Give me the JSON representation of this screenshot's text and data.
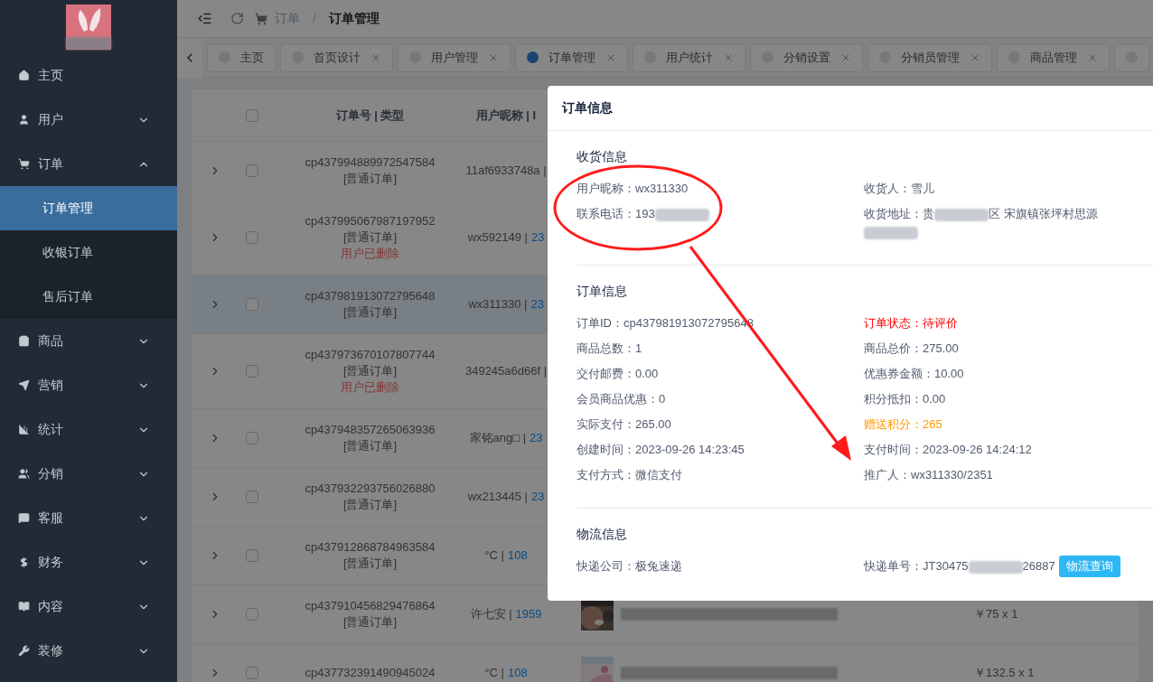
{
  "sidebar": {
    "items": [
      {
        "label": "主页"
      },
      {
        "label": "用户",
        "expanded": false
      },
      {
        "label": "订单",
        "expanded": true,
        "children": [
          {
            "label": "订单管理",
            "selected": true
          },
          {
            "label": "收银订单",
            "selected": false
          },
          {
            "label": "售后订单",
            "selected": false
          }
        ]
      },
      {
        "label": "商品",
        "expanded": false
      },
      {
        "label": "营销",
        "expanded": false
      },
      {
        "label": "统计",
        "expanded": false
      },
      {
        "label": "分销",
        "expanded": false
      },
      {
        "label": "客服",
        "expanded": false
      },
      {
        "label": "财务",
        "expanded": false
      },
      {
        "label": "内容",
        "expanded": false
      },
      {
        "label": "装修",
        "expanded": false
      }
    ]
  },
  "header": {
    "separator": "/",
    "breadcrumb": [
      {
        "label": "订单",
        "current": false
      },
      {
        "label": "订单管理",
        "current": true
      }
    ]
  },
  "tabs": [
    {
      "label": "主页",
      "selected": false,
      "closable": false
    },
    {
      "label": "首页设计",
      "selected": false,
      "closable": true
    },
    {
      "label": "用户管理",
      "selected": false,
      "closable": true
    },
    {
      "label": "订单管理",
      "selected": true,
      "closable": true
    },
    {
      "label": "用户统计",
      "selected": false,
      "closable": true
    },
    {
      "label": "分销设置",
      "selected": false,
      "closable": true
    },
    {
      "label": "分销员管理",
      "selected": false,
      "closable": true
    },
    {
      "label": "商品管理",
      "selected": false,
      "closable": true
    },
    {
      "selected": false,
      "closable": false
    }
  ],
  "table": {
    "all_checked": false,
    "columns": [
      "订单号 | 类型",
      "用户昵称 | I"
    ],
    "rows": [
      {
        "order_no": "cp437994889972547584",
        "type": "[普通订单]",
        "selected": false,
        "user": "11af6933748a |"
      },
      {
        "order_no": "cp437995067987197952",
        "type": "[普通订单]",
        "note": "用户已删除",
        "selected": false,
        "user": "wx592149 |",
        "user_id": "23"
      },
      {
        "order_no": "cp437981913072795648",
        "type": "[普通订单]",
        "selected": true,
        "user": "wx311330 |",
        "user_id": "23"
      },
      {
        "order_no": "cp437973670107807744",
        "type": "[普通订单]",
        "note": "用户已删除",
        "selected": false,
        "user": "349245a6d66f |"
      },
      {
        "order_no": "cp437948357265063936",
        "type": "[普通订单]",
        "selected": false,
        "user": "家铭ang□ |",
        "user_id": "23"
      },
      {
        "order_no": "cp437932293756026880",
        "type": "[普通订单]",
        "selected": false,
        "user": "wx213445 |",
        "user_id": "23"
      },
      {
        "order_no": "cp437912868784963584",
        "type": "[普通订单]",
        "selected": false,
        "user": "°C |",
        "user_id": "108"
      },
      {
        "order_no": "cp437910456829476864",
        "type": "[普通订单]",
        "selected": false,
        "user": "许七安 |",
        "user_id": "1959",
        "product": {
          "kind": "picture",
          "price": "￥75 x 1"
        }
      },
      {
        "order_no": "cp437732391490945024",
        "selected": false,
        "user": "°C |",
        "user_id": "108",
        "product": {
          "kind": "picture",
          "price": "￥132.5 x 1"
        }
      }
    ]
  },
  "modal": {
    "title": "订单信息",
    "sections": [
      {
        "title": "收货信息",
        "fields": [
          {
            "label": "用户昵称：",
            "segments": [
              {
                "kind": "text",
                "text": "wx311330"
              }
            ]
          },
          {
            "label": "收货人：",
            "segments": [
              {
                "kind": "text",
                "text": "雪儿"
              }
            ]
          },
          {
            "label": "联系电话：",
            "segments": [
              {
                "kind": "text",
                "text": "193"
              },
              {
                "kind": "redacted"
              }
            ]
          },
          {
            "label": "收货地址：",
            "segments": [
              {
                "kind": "text",
                "text": "贵"
              },
              {
                "kind": "redacted"
              },
              {
                "kind": "text",
                "text": "区 宋旗镇张坪村思源"
              },
              {
                "kind": "redacted"
              }
            ]
          }
        ]
      },
      {
        "title": "订单信息",
        "fields": [
          {
            "label": "订单ID：",
            "segments": [
              {
                "kind": "text",
                "text": "cp437981913072795648"
              }
            ]
          },
          {
            "label": "订单状态：",
            "color": "#ff0000",
            "segments": [
              {
                "kind": "text",
                "text": "待评价"
              }
            ]
          },
          {
            "label": "商品总数：",
            "segments": [
              {
                "kind": "text",
                "text": "1"
              }
            ]
          },
          {
            "label": "商品总价：",
            "segments": [
              {
                "kind": "text",
                "text": "275.00"
              }
            ]
          },
          {
            "label": "交付邮费：",
            "segments": [
              {
                "kind": "text",
                "text": "0.00"
              }
            ]
          },
          {
            "label": "优惠券金额：",
            "segments": [
              {
                "kind": "text",
                "text": "10.00"
              }
            ]
          },
          {
            "label": "会员商品优惠：",
            "segments": [
              {
                "kind": "text",
                "text": "0"
              }
            ]
          },
          {
            "label": "积分抵扣：",
            "segments": [
              {
                "kind": "text",
                "text": "0.00"
              }
            ]
          },
          {
            "label": "实际支付：",
            "segments": [
              {
                "kind": "text",
                "text": "265.00"
              }
            ]
          },
          {
            "label": "赠送积分：",
            "color": "#ff9900",
            "segments": [
              {
                "kind": "text",
                "text": "265"
              }
            ]
          },
          {
            "label": "创建时间：",
            "segments": [
              {
                "kind": "text",
                "text": "2023-09-26 14:23:45"
              }
            ]
          },
          {
            "label": "支付时间：",
            "segments": [
              {
                "kind": "text",
                "text": "2023-09-26 14:24:12"
              }
            ]
          },
          {
            "label": "支付方式：",
            "segments": [
              {
                "kind": "text",
                "text": "微信支付"
              }
            ]
          },
          {
            "label": "推广人：",
            "segments": [
              {
                "kind": "text",
                "text": "wx311330/2351"
              }
            ]
          }
        ]
      },
      {
        "title": "物流信息",
        "fields": [
          {
            "label": "快递公司：",
            "segments": [
              {
                "kind": "text",
                "text": "极兔速递"
              }
            ]
          },
          {
            "label": "快递单号：",
            "segments": [
              {
                "kind": "text",
                "text": "JT30475"
              },
              {
                "kind": "redacted"
              },
              {
                "kind": "text",
                "text": "26887"
              }
            ],
            "button": "物流查询"
          }
        ]
      }
    ]
  }
}
